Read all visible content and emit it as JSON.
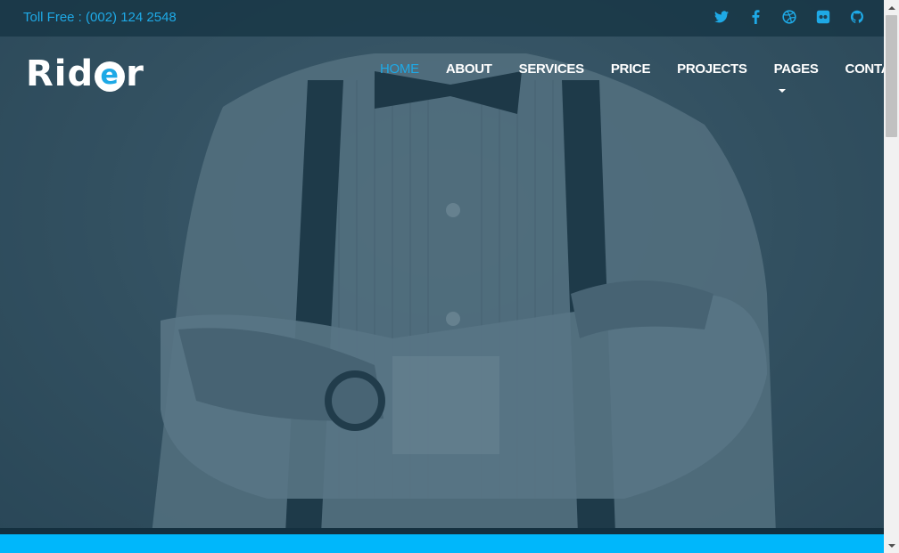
{
  "topbar": {
    "toll_free": "Toll Free : (002) 124 2548",
    "social_icons": [
      "twitter-icon",
      "facebook-icon",
      "dribbble-icon",
      "flickr-icon",
      "github-icon"
    ]
  },
  "logo": {
    "text_before": "Rid",
    "text_circle": "e",
    "text_after": "r"
  },
  "nav": {
    "items": [
      {
        "label": "HOME",
        "active": true
      },
      {
        "label": "ABOUT"
      },
      {
        "label": "SERVICES"
      },
      {
        "label": "PRICE"
      },
      {
        "label": "PROJECTS"
      },
      {
        "label": "PAGES",
        "dropdown": true
      },
      {
        "label": "CONTACT"
      }
    ]
  },
  "colors": {
    "accent": "#1ea9e6",
    "bottom_bar": "#00b7fb",
    "overlay": "#224254"
  }
}
